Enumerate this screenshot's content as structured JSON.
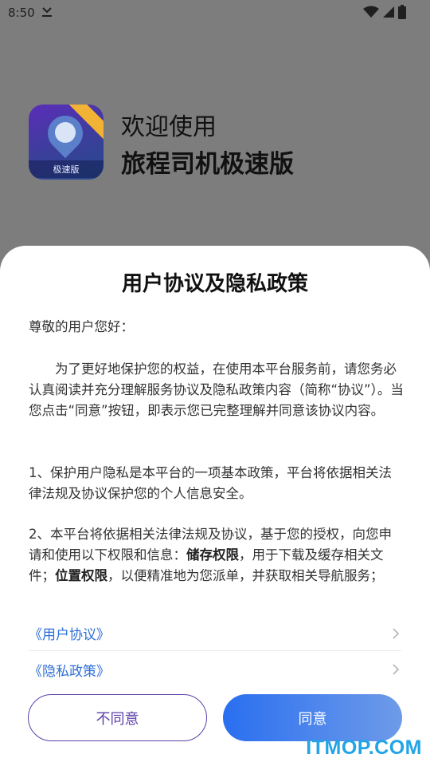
{
  "status_bar": {
    "time": "8:50",
    "icons": [
      "download-done-icon",
      "wifi-icon",
      "signal-icon",
      "battery-icon"
    ]
  },
  "splash": {
    "app_icon_label": "极速版",
    "welcome_line1": "欢迎使用",
    "welcome_line2": "旅程司机极速版"
  },
  "dialog": {
    "title": "用户协议及隐私政策",
    "greeting": "尊敬的用户您好：",
    "paragraph1": "　　为了更好地保护您的权益，在使用本平台服务前，请您务必认真阅读并充分理解服务协议及隐私政策内容（简称“协议”）。当您点击“同意”按钮，即表示您已完整理解并同意该协议内容。",
    "paragraph2": "1、保护用户隐私是本平台的一项基本政策，平台将依据相关法律法规及协议保护您的个人信息安全。",
    "paragraph3": {
      "part1": "2、本平台将依据相关法律法规及协议，基于您的授权，向您申请和使用以下权限和信息：",
      "bold1": "储存权限",
      "part2": "，用于下载及缓存相关文件；",
      "bold2": "位置权限",
      "part3": "，以便精准地为您派单，并获取相关导航服务；"
    },
    "links": [
      {
        "label": "《用户协议》"
      },
      {
        "label": "《隐私政策》"
      }
    ],
    "disagree_label": "不同意",
    "agree_label": "同意"
  },
  "watermark": "ITMOP.COM",
  "colors": {
    "accent": "#2f6fd6",
    "agree_start": "#2a6ff0",
    "agree_end": "#6e9be9",
    "disagree_border": "#5b3fa8",
    "overlay": "#7d7d7d",
    "watermark": "#22a4e6"
  }
}
